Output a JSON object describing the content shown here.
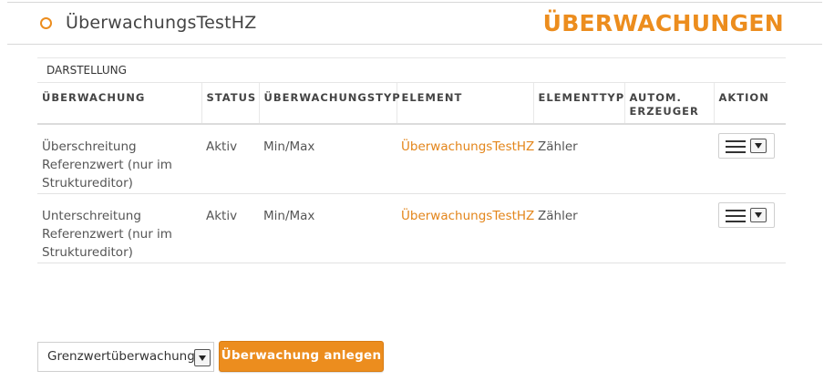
{
  "header": {
    "title": "ÜberwachungsTestHZ",
    "section": "ÜBERWACHUNGEN",
    "accent_color": "#ec8d1e"
  },
  "panel": {
    "title": "DARSTELLUNG",
    "columns": [
      "ÜBERWACHUNG",
      "STATUS",
      "ÜBERWACHUNGSTYP",
      "ELEMENT",
      "ELEMENTTYP",
      "AUTOM. ERZEUGER",
      "AKTION"
    ],
    "rows": [
      {
        "name": "Überschreitung Referenzwert (nur im Struktureditor)",
        "status": "Aktiv",
        "type": "Min/Max",
        "element": "ÜberwachungsTestHZ",
        "element_type": "Zähler",
        "creator": "",
        "action_icon": "menu-icon"
      },
      {
        "name": "Unterschreitung Referenzwert (nur im Struktureditor)",
        "status": "Aktiv",
        "type": "Min/Max",
        "element": "ÜberwachungsTestHZ",
        "element_type": "Zähler",
        "creator": "",
        "action_icon": "menu-icon"
      }
    ]
  },
  "footer": {
    "select_value": "Grenzwertüberwachung",
    "create_label": "Überwachung anlegen"
  }
}
